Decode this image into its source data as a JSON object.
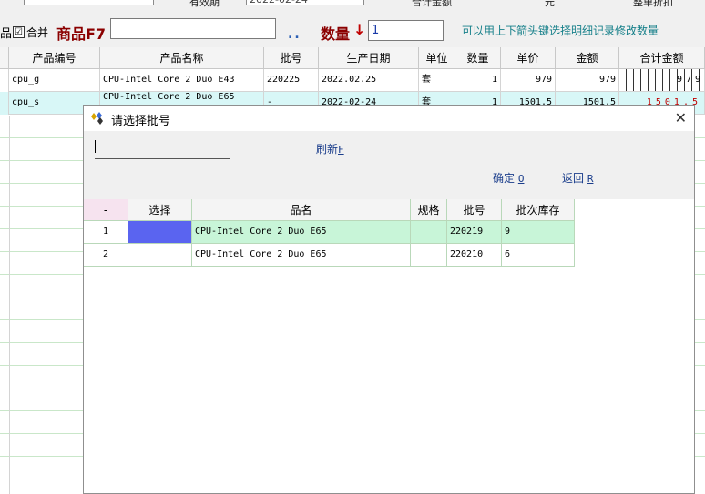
{
  "top_strip": {
    "date_label": "有效期",
    "date_value": "2022-02-24",
    "amount_label": "合计金额",
    "discount_label": "整单折扣",
    "yuan": "元"
  },
  "form": {
    "product_prefix": "品",
    "merge_label": "合并",
    "merge_checked": "☑",
    "product_label": "商品F7",
    "product_value": "",
    "dots": "..",
    "qty_label": "数量",
    "qty_arrow": "↓",
    "qty_value": "1",
    "hint": "可以用上下箭头键选择明细记录修改数量"
  },
  "main_table": {
    "columns": [
      "产品编号",
      "产品名称",
      "批号",
      "生产日期",
      "单位",
      "数量",
      "单价",
      "金额",
      "合计金额"
    ],
    "rows": [
      {
        "code": "cpu_g",
        "name": "CPU-Intel Core 2 Duo E43",
        "batch": "220225",
        "date": "2022.02.25",
        "unit": "套",
        "qty": "1",
        "price": "979",
        "amount": "979",
        "total": "979"
      },
      {
        "code": "cpu_s",
        "name": "CPU-Intel Core 2 Duo E65",
        "batch": "-",
        "date": "2022-02-24",
        "unit": "套",
        "qty": "1",
        "price": "1501.5",
        "amount": "1501.5",
        "total": "1501.5"
      }
    ]
  },
  "dialog": {
    "title": "请选择批号",
    "close": "✕",
    "refresh": "刷新",
    "refresh_key": "F",
    "ok": "确定",
    "ok_key": "O",
    "back": "返回",
    "back_key": "R",
    "columns": [
      "-",
      "选择",
      "品名",
      "规格",
      "批号",
      "批次库存"
    ],
    "rows": [
      {
        "idx": "1",
        "name": "CPU-Intel Core 2 Duo E65",
        "spec": "",
        "batch": "220219",
        "stock": "9"
      },
      {
        "idx": "2",
        "name": "CPU-Intel Core 2 Duo E65",
        "spec": "",
        "batch": "220210",
        "stock": "6"
      }
    ]
  }
}
